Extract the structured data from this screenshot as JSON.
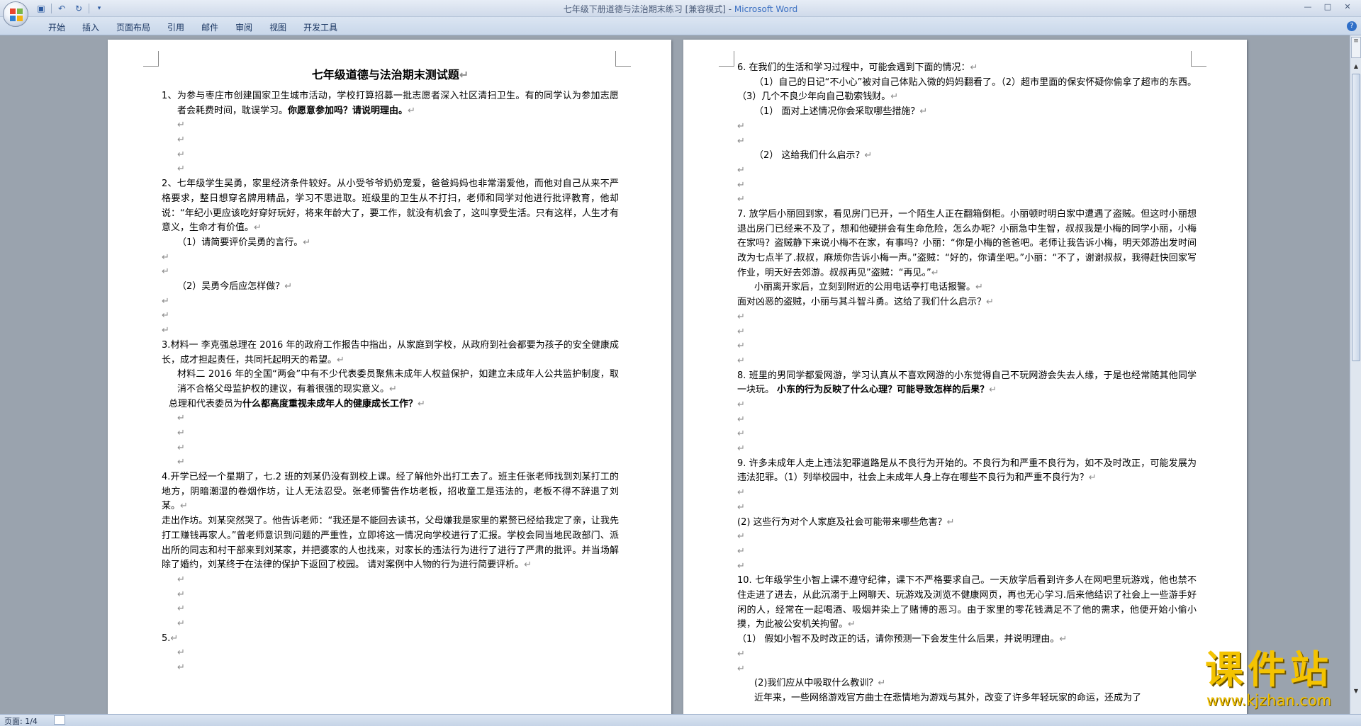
{
  "window": {
    "title": "七年级下册道德与法治期末练习 [兼容模式] - ",
    "app": "Microsoft Word"
  },
  "ribbon": {
    "tabs": [
      "开始",
      "插入",
      "页面布局",
      "引用",
      "邮件",
      "审阅",
      "视图",
      "开发工具"
    ]
  },
  "status": {
    "page": "页面: 1/4"
  },
  "colors": {
    "accent": "#3a6fc2",
    "watermark": "#f4c300"
  },
  "icons": [
    "office-orb-icon",
    "save-icon",
    "undo-icon",
    "redo-icon",
    "customize-icon",
    "help-icon",
    "paragraph-mark-icon",
    "spell-check-icon"
  ],
  "page1": {
    "title": "七年级道德与法治期末测试题",
    "q1": {
      "num": "1、",
      "text": "为参与枣庄市创建国家卫生城市活动，学校打算招募一批志愿者深入社区清扫卫生。有的同学认为参加志愿者会耗费时间，耽误学习。",
      "bold": "你愿意参加吗？请说明理由。"
    },
    "q2": {
      "text": "2、七年级学生吴勇，家里经济条件较好。从小受爷爷奶奶宠爱，爸爸妈妈也非常溺爱他，而他对自己从来不严格要求，整日想穿名牌用精品，学习不思进取。班级里的卫生从不打扫，老师和同学对他进行批评教育，他却说：“年纪小更应该吃好穿好玩好，将来年龄大了，要工作，就没有机会了，这叫享受生活。只有这样，人生才有意义，生命才有价值。",
      "sub1": "（1）请简要评价吴勇的言行。",
      "sub2": "（2）吴勇今后应怎样做？"
    },
    "q3": {
      "m1": "3.材料一  李克强总理在 2016 年的政府工作报告中指出，从家庭到学校，从政府到社会都要为孩子的安全健康成长，成才担起责任，共同托起明天的希望。",
      "m2": "材料二  2016 年的全国“两会”中有不少代表委员聚焦未成年人权益保护，如建立未成年人公共监护制度，取消不合格父母监护权的建议，有着很强的现实意义。",
      "q": "总理和代表委员为",
      "bold": "什么都高度重视未成年人的健康成长工作？"
    },
    "q4": {
      "p1": "4.开学已经一个星期了，七.2 班的刘某仍没有到校上课。经了解他外出打工去了。班主任张老师找到刘某打工的地方，阴暗潮湿的卷烟作坊，让人无法忍受。张老师警告作坊老板，招收童工是违法的，老板不得不辞退了刘某。",
      "p2": "走出作坊。刘某突然哭了。他告诉老师：“我还是不能回去读书，父母嫌我是家里的累赘已经给我定了亲，让我先打工赚钱再家人。”曾老师意识到问题的严重性，立即将这一情况向学校进行了汇报。学校会同当地民政部门、派出所的同志和村干部来到刘某家，并把婆家的人也找来，对家长的违法行为进行了进行了严肃的批评。并当场解除了婚约，刘某终于在法律的保护下返回了校园。      请对案例中人物的行为进行简要评析。"
    },
    "q5": "5."
  },
  "page2": {
    "q6": {
      "intro": "6. 在我们的生活和学习过程中，可能会遇到下面的情况：",
      "cases": "（1）自己的日记“不小心”被对自己体贴入微的妈妈翻看了。（2）超市里面的保安怀疑你偷拿了超市的东西。（3）几个不良少年向自己勒索钱财。",
      "sub1": "（1）   面对上述情况你会采取哪些措施？",
      "sub2": "（2）   这给我们什么启示？"
    },
    "q7": {
      "p1": "7.    放学后小丽回到家，看见房门已开，一个陌生人正在翻箱倒柜。小丽顿时明白家中遭遇了盗贼。但这时小丽想退出房门已经来不及了，想和他硬拼会有生命危险，怎么办呢？小丽急中生智，叔叔我是小梅的同学小丽，小梅在家吗？盗贼静下来说小梅不在家，有事吗？小丽：“你是小梅的爸爸吧。老师让我告诉小梅，明天郊游出发时间改为七点半了.叔叔，麻烦你告诉小梅一声。”盗贼：“好的，你请坐吧。”小丽：“不了，谢谢叔叔，我得赶快回家写作业，明天好去郊游。叔叔再见”盗贼：“再见。”",
      "p2": "小丽离开家后，立刻到附近的公用电话亭打电话报警。",
      "q": "面对凶恶的盗贼，小丽与其斗智斗勇。这给了我们什么启示？"
    },
    "q8": {
      "text": "8. 班里的男同学都爱网游，学习认真从不喜欢网游的小东觉得自己不玩网游会失去人缘，于是也经常随其他同学一块玩。        ",
      "bold": "小东的行为反映了什么心理？可能导致怎样的后果？"
    },
    "q9": {
      "text": "9. 许多未成年人走上违法犯罪道路是从不良行为开始的。不良行为和严重不良行为，如不及时改正，可能发展为违法犯罪。（1）列举校园中，社会上未成年人身上存在哪些不良行为和严重不良行为？",
      "sub2": "(2) 这些行为对个人家庭及社会可能带来哪些危害？"
    },
    "q10": {
      "text": "10. 七年级学生小智上课不遵守纪律，课下不严格要求自己。一天放学后看到许多人在网吧里玩游戏，他也禁不住走进了进去，从此沉溺于上网聊天、玩游戏及浏览不健康网页，再也无心学习.后来他结识了社会上一些游手好闲的人，经常在一起喝酒、吸烟并染上了赌博的恶习。由于家里的零花钱满足不了他的需求，他便开始小偷小摸，为此被公安机关拘留。",
      "sub1": "（1）   假如小智不及时改正的话，请你预测一下会发生什么后果，并说明理由。",
      "sub2": "(2)我们应从中吸取什么教训？",
      "cut": "近年来，一些网络游戏官方曲士在悲情地为游戏与其外，改变了许多年轻玩家的命运，还成为了"
    }
  },
  "watermark": {
    "cn": "课件站",
    "url": "www.kjzhan.com"
  }
}
